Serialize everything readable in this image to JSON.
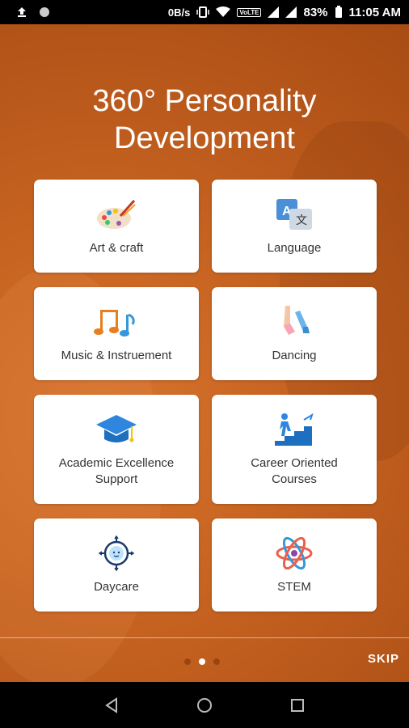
{
  "status_bar": {
    "net_speed": "0B/s",
    "volte": "VoLTE",
    "battery": "83%",
    "time": "11:05 AM"
  },
  "title_line1": "360° Personality",
  "title_line2": "Development",
  "categories": [
    {
      "label": "Art & craft",
      "icon": "palette-icon"
    },
    {
      "label": "Language",
      "icon": "translate-icon"
    },
    {
      "label": "Music & Instruement",
      "icon": "music-notes-icon"
    },
    {
      "label": "Dancing",
      "icon": "ballet-shoes-icon"
    },
    {
      "label": "Academic Excellence Support",
      "icon": "graduation-cap-icon"
    },
    {
      "label": "Career Oriented Courses",
      "icon": "career-stairs-icon"
    },
    {
      "label": "Daycare",
      "icon": "baby-face-icon"
    },
    {
      "label": "STEM",
      "icon": "atom-icon"
    }
  ],
  "pager": {
    "current_page": 2,
    "total_pages": 3
  },
  "skip_label": "SKIP",
  "colors": {
    "background": "#c96522",
    "card": "#ffffff",
    "text": "#333333"
  }
}
